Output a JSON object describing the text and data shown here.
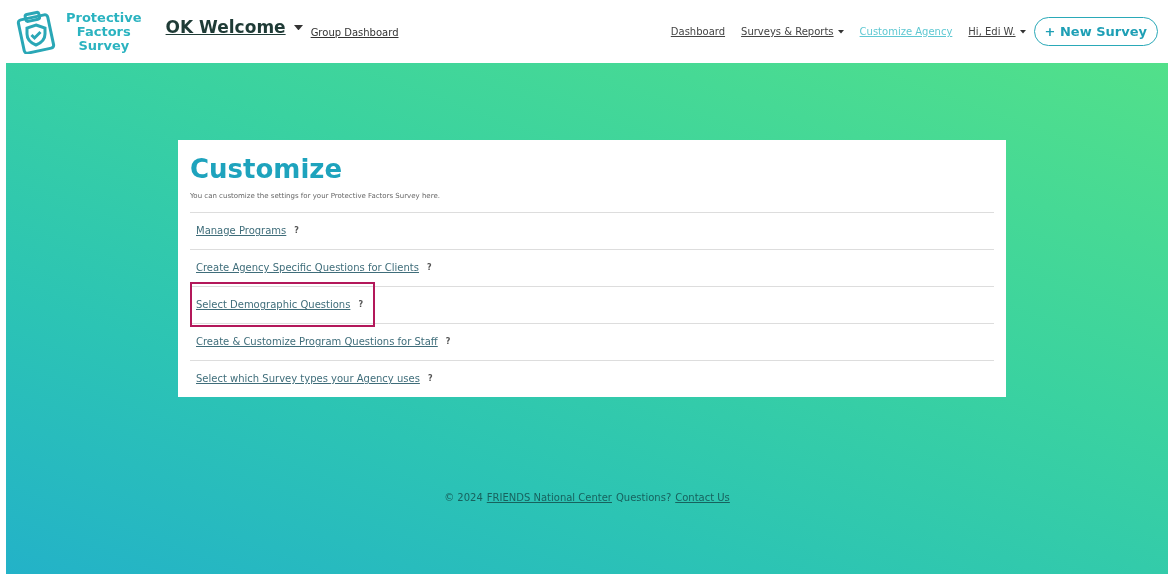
{
  "header": {
    "logo_text": [
      "Protective",
      "Factors",
      "Survey"
    ],
    "agency": "OK Welcome",
    "group_link": "Group Dashboard",
    "nav": [
      {
        "label": "Dashboard",
        "dropdown": false,
        "selected": false
      },
      {
        "label": "Surveys & Reports",
        "dropdown": true,
        "selected": false
      },
      {
        "label": "Customize Agency",
        "dropdown": false,
        "selected": true
      },
      {
        "label": "Hi, Edi W.",
        "dropdown": true,
        "selected": false
      }
    ],
    "new_button": "+ New Survey"
  },
  "card": {
    "title": "Customize",
    "subtitle": "You can customize the settings for your Protective Factors Survey here.",
    "items": [
      {
        "label": "Manage Programs",
        "help": "?",
        "highlighted": false
      },
      {
        "label": "Create Agency Specific Questions for Clients",
        "help": "?",
        "highlighted": false
      },
      {
        "label": "Select Demographic Questions",
        "help": "?",
        "highlighted": true
      },
      {
        "label": "Create & Customize Program Questions for Staff",
        "help": "?",
        "highlighted": false
      },
      {
        "label": "Select which Survey types your Agency uses",
        "help": "?",
        "highlighted": false
      }
    ]
  },
  "footer": {
    "copyright": "© 2024",
    "org_link": "FRIENDS National Center",
    "question": "Questions?",
    "contact_link": "Contact Us"
  }
}
